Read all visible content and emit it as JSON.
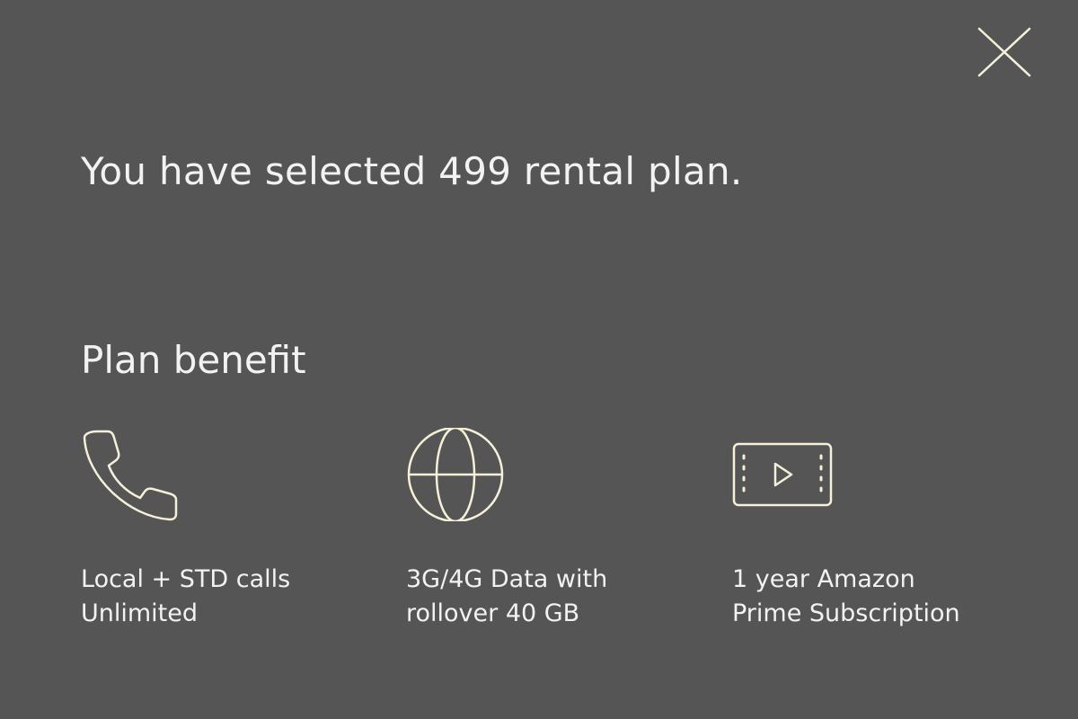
{
  "dialog": {
    "headline": "You have selected 499 rental plan.",
    "section_title": "Plan benefit",
    "close_icon": "close-icon",
    "benefits": [
      {
        "icon": "phone-icon",
        "line1": "Local + STD calls",
        "line2": "Unlimited"
      },
      {
        "icon": "globe-icon",
        "line1": "3G/4G Data with",
        "line2": "rollover 40 GB"
      },
      {
        "icon": "video-play-icon",
        "line1": "1 year Amazon",
        "line2": "Prime Subscription"
      }
    ]
  },
  "colors": {
    "background": "#555555",
    "text": "#f2f2f2",
    "icon_stroke": "#f5f0d8"
  }
}
